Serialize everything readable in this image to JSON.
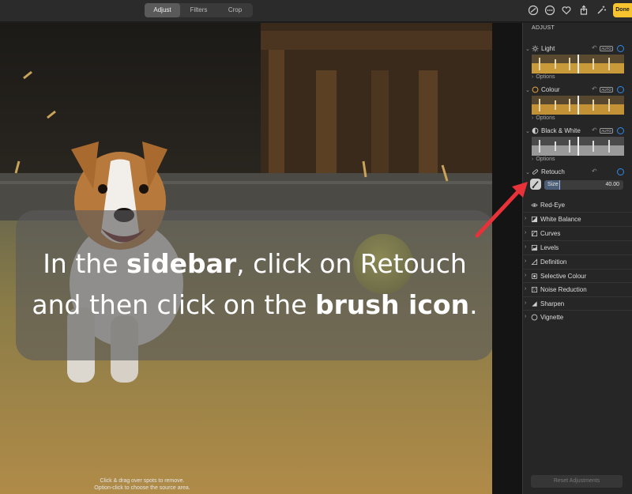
{
  "toolbar": {
    "tabs": [
      {
        "label": "Adjust",
        "active": true
      },
      {
        "label": "Filters",
        "active": false
      },
      {
        "label": "Crop",
        "active": false
      }
    ],
    "icons": [
      "info-icon",
      "more-icon",
      "heart-icon",
      "share-icon",
      "magic-wand-icon"
    ],
    "done_label": "Done",
    "done_color": "#f7c32e"
  },
  "photo": {
    "hint_line1": "Click & drag over spots to remove.",
    "hint_line2": "Option-click to choose the source area."
  },
  "caption": {
    "part1": "In the ",
    "bold1": "sidebar",
    "part2": ", click on Retouch and then click on the ",
    "bold2": "brush icon",
    "part3": "."
  },
  "sidebar": {
    "title": "ADJUST",
    "accent_color": "#2e8bf0",
    "sections": [
      {
        "label": "Light",
        "icon": "sun-icon",
        "auto": "AUTO",
        "options": "Options"
      },
      {
        "label": "Colour",
        "icon": "colour-circle-icon",
        "auto": "AUTO",
        "options": "Options"
      },
      {
        "label": "Black & White",
        "icon": "half-circle-icon",
        "auto": "AUTO",
        "options": "Options"
      }
    ],
    "retouch": {
      "label": "Retouch",
      "icon": "bandage-icon",
      "size_label": "Size",
      "size_value": "40.00",
      "size_fraction": 0.2
    },
    "adjustments": [
      {
        "label": "Red-Eye",
        "icon": "eye-icon"
      },
      {
        "label": "White Balance",
        "icon": "white-balance-icon"
      },
      {
        "label": "Curves",
        "icon": "curves-icon"
      },
      {
        "label": "Levels",
        "icon": "levels-icon"
      },
      {
        "label": "Definition",
        "icon": "definition-icon"
      },
      {
        "label": "Selective Colour",
        "icon": "selective-colour-icon"
      },
      {
        "label": "Noise Reduction",
        "icon": "noise-icon"
      },
      {
        "label": "Sharpen",
        "icon": "sharpen-icon"
      },
      {
        "label": "Vignette",
        "icon": "vignette-icon"
      }
    ],
    "reset_label": "Reset Adjustments"
  },
  "annotation": {
    "arrow_color": "#e8323a"
  }
}
